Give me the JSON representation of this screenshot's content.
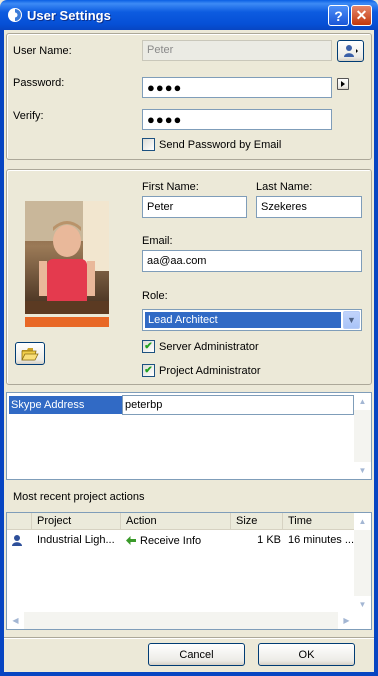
{
  "window": {
    "title": "User Settings"
  },
  "account": {
    "user_name_label": "User Name:",
    "user_name_value": "Peter",
    "password_label": "Password:",
    "password_value": "●●●●",
    "verify_label": "Verify:",
    "verify_value": "●●●●",
    "send_password_label": "Send Password by Email",
    "send_password_checked": false
  },
  "profile": {
    "first_name_label": "First Name:",
    "first_name_value": "Peter",
    "last_name_label": "Last Name:",
    "last_name_value": "Szekeres",
    "email_label": "Email:",
    "email_value": "aa@aa.com",
    "role_label": "Role:",
    "role_value": "Lead Architect",
    "server_admin_label": "Server Administrator",
    "server_admin_checked": true,
    "project_admin_label": "Project Administrator",
    "project_admin_checked": true
  },
  "properties": [
    {
      "key": "Skype Address",
      "value": "peterbp"
    }
  ],
  "recent": {
    "section_label": "Most recent project actions",
    "columns": [
      "Project",
      "Action",
      "Size",
      "Time"
    ],
    "rows": [
      {
        "project": "Industrial Ligh...",
        "action": "Receive Info",
        "size": "1 KB",
        "time": "16 minutes ..."
      }
    ]
  },
  "footer": {
    "cancel_label": "Cancel",
    "ok_label": "OK"
  },
  "colors": {
    "titlebar": "#0a5fe4",
    "selection": "#316ac5",
    "photo_bar": "#e86826",
    "background": "#ece9d8"
  }
}
